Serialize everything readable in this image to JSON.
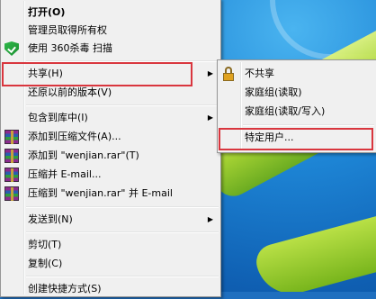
{
  "main_menu": {
    "items": [
      {
        "label": "打开(O)",
        "bold": true
      },
      {
        "label": "管理员取得所有权"
      },
      {
        "label": "使用 360杀毒 扫描"
      },
      {
        "label": "共享(H)"
      },
      {
        "label": "还原以前的版本(V)"
      },
      {
        "label": "包含到库中(I)"
      },
      {
        "label": "添加到压缩文件(A)..."
      },
      {
        "label": "添加到 \"wenjian.rar\"(T)"
      },
      {
        "label": "压缩并 E-mail..."
      },
      {
        "label": "压缩到 \"wenjian.rar\" 并 E-mail"
      },
      {
        "label": "发送到(N)"
      },
      {
        "label": "剪切(T)"
      },
      {
        "label": "复制(C)"
      },
      {
        "label": "创建快捷方式(S)"
      }
    ]
  },
  "share_submenu": {
    "items": [
      {
        "label": "不共享"
      },
      {
        "label": "家庭组(读取)"
      },
      {
        "label": "家庭组(读取/写入)"
      },
      {
        "label": "特定用户..."
      }
    ]
  },
  "colors": {
    "highlight_box": "#d9363e",
    "menu_background": "#f0f0f0"
  }
}
